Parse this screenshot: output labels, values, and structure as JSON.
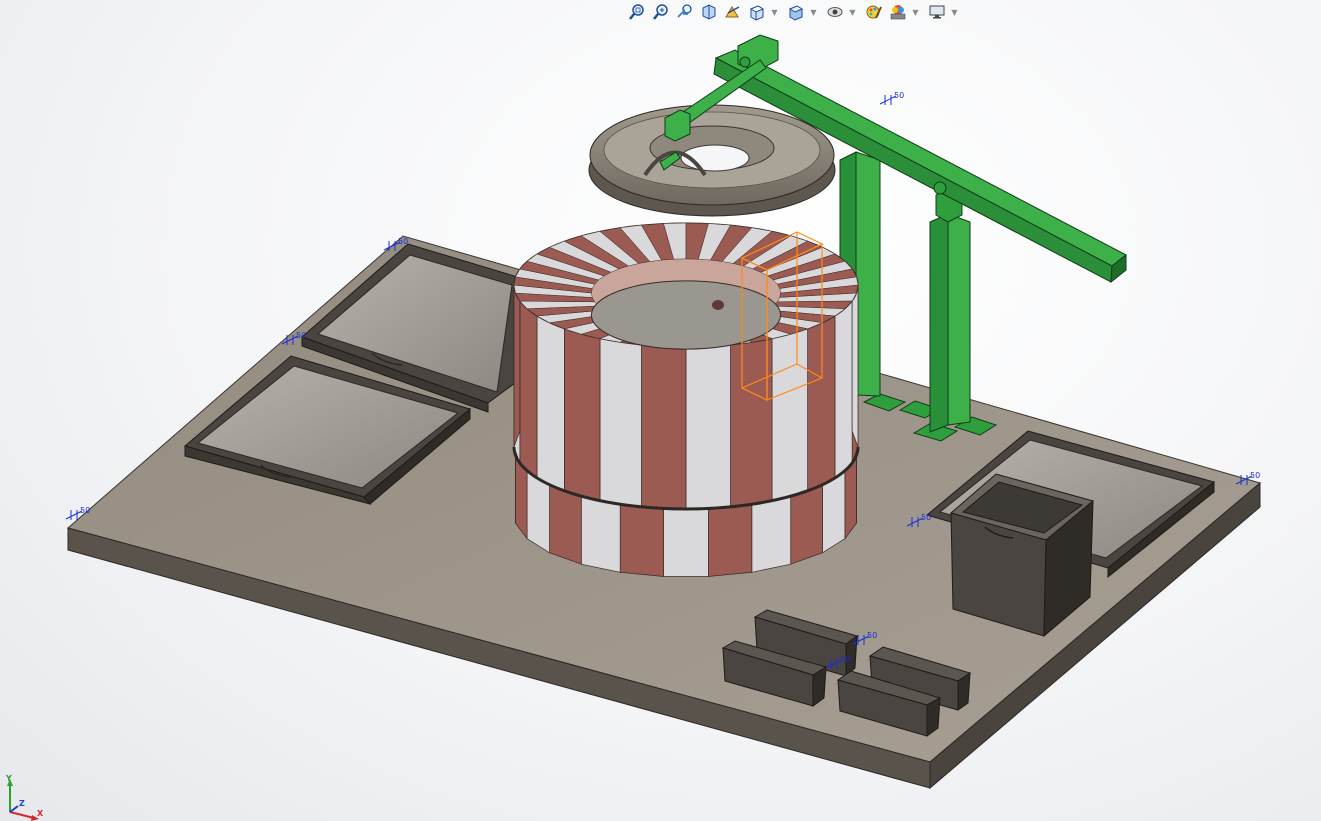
{
  "app": {
    "viewport_background": "#f4f5f7"
  },
  "toolbar": {
    "buttons": [
      {
        "name": "zoom-to-fit",
        "icon": "zoom-fit-icon",
        "has_dropdown": false
      },
      {
        "name": "zoom-to-area",
        "icon": "zoom-area-icon",
        "has_dropdown": false
      },
      {
        "name": "previous-view",
        "icon": "previous-view-icon",
        "has_dropdown": false
      },
      {
        "name": "section-view",
        "icon": "section-view-icon",
        "has_dropdown": false
      },
      {
        "name": "dynamic-annotation-views",
        "icon": "dynamic-annotation-icon",
        "has_dropdown": false
      },
      {
        "name": "view-orientation",
        "icon": "view-orientation-icon",
        "has_dropdown": true
      },
      {
        "name": "display-style",
        "icon": "display-style-icon",
        "has_dropdown": true
      },
      {
        "name": "hide-show-items",
        "icon": "hide-show-icon",
        "has_dropdown": true
      },
      {
        "name": "edit-appearance",
        "icon": "edit-appearance-icon",
        "has_dropdown": false
      },
      {
        "name": "apply-scene",
        "icon": "apply-scene-icon",
        "has_dropdown": true
      },
      {
        "name": "view-settings",
        "icon": "view-settings-icon",
        "has_dropdown": true
      }
    ]
  },
  "colors": {
    "base_plate_top": "#9e9589",
    "base_plate_side": "#5e574f",
    "brick_red": "#9b5a52",
    "brick_light": "#d9d9dc",
    "frame_green": "#2e9a3a",
    "tire_gray": "#8e877c",
    "tray_dark": "#4a4540",
    "tray_inner": "#a7a19a",
    "dimension_blue": "#1a2fd6",
    "selection_orange": "#ff8a1c"
  },
  "triad": {
    "x_label": "X",
    "y_label": "Y",
    "z_label": "Z"
  },
  "dimensions": [
    {
      "label": "50"
    },
    {
      "label": "50"
    },
    {
      "label": "50"
    },
    {
      "label": "50"
    },
    {
      "label": "50"
    },
    {
      "label": "50"
    },
    {
      "label": "50"
    },
    {
      "label": "50"
    }
  ]
}
